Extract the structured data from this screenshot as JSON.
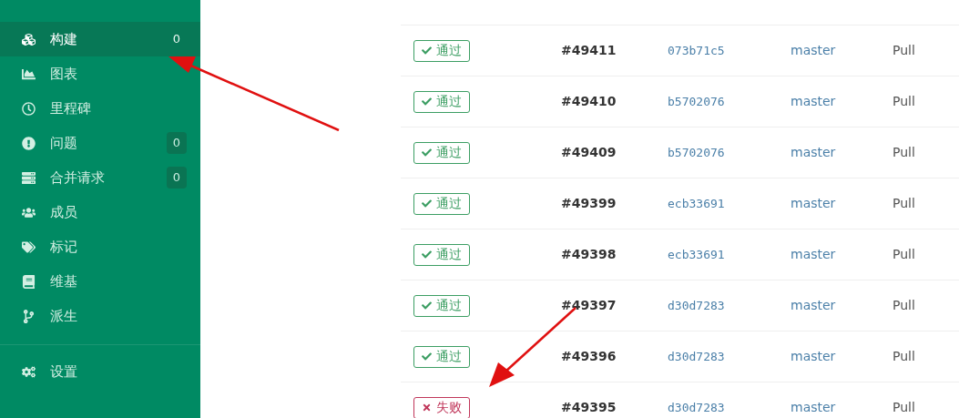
{
  "sidebar": {
    "items": [
      {
        "label": "构建",
        "count": "0",
        "selected": true
      },
      {
        "label": "图表",
        "selected": false
      },
      {
        "label": "里程碑",
        "selected": false
      },
      {
        "label": "问题",
        "count": "0",
        "selected": false
      },
      {
        "label": "合并请求",
        "count": "0",
        "selected": false
      },
      {
        "label": "成员",
        "selected": false
      },
      {
        "label": "标记",
        "selected": false
      },
      {
        "label": "维基",
        "selected": false
      },
      {
        "label": "派生",
        "selected": false
      }
    ],
    "settings": {
      "label": "设置",
      "selected": false
    }
  },
  "table": {
    "rows": [
      {
        "kind": "passed",
        "status_label": "通过",
        "number": "#49411",
        "commit": "073b71c5",
        "branch": "master",
        "column_5": "Pull"
      },
      {
        "kind": "passed",
        "status_label": "通过",
        "number": "#49410",
        "commit": "b5702076",
        "branch": "master",
        "column_5": "Pull"
      },
      {
        "kind": "passed",
        "status_label": "通过",
        "number": "#49409",
        "commit": "b5702076",
        "branch": "master",
        "column_5": "Pull"
      },
      {
        "kind": "passed",
        "status_label": "通过",
        "number": "#49399",
        "commit": "ecb33691",
        "branch": "master",
        "column_5": "Pull"
      },
      {
        "kind": "passed",
        "status_label": "通过",
        "number": "#49398",
        "commit": "ecb33691",
        "branch": "master",
        "column_5": "Pull"
      },
      {
        "kind": "passed",
        "status_label": "通过",
        "number": "#49397",
        "commit": "d30d7283",
        "branch": "master",
        "column_5": "Pull"
      },
      {
        "kind": "passed",
        "status_label": "通过",
        "number": "#49396",
        "commit": "d30d7283",
        "branch": "master",
        "column_5": "Pull"
      },
      {
        "kind": "failed",
        "status_label": "失败",
        "number": "#49395",
        "commit": "d30d7283",
        "branch": "master",
        "column_5": "Pull"
      }
    ]
  }
}
